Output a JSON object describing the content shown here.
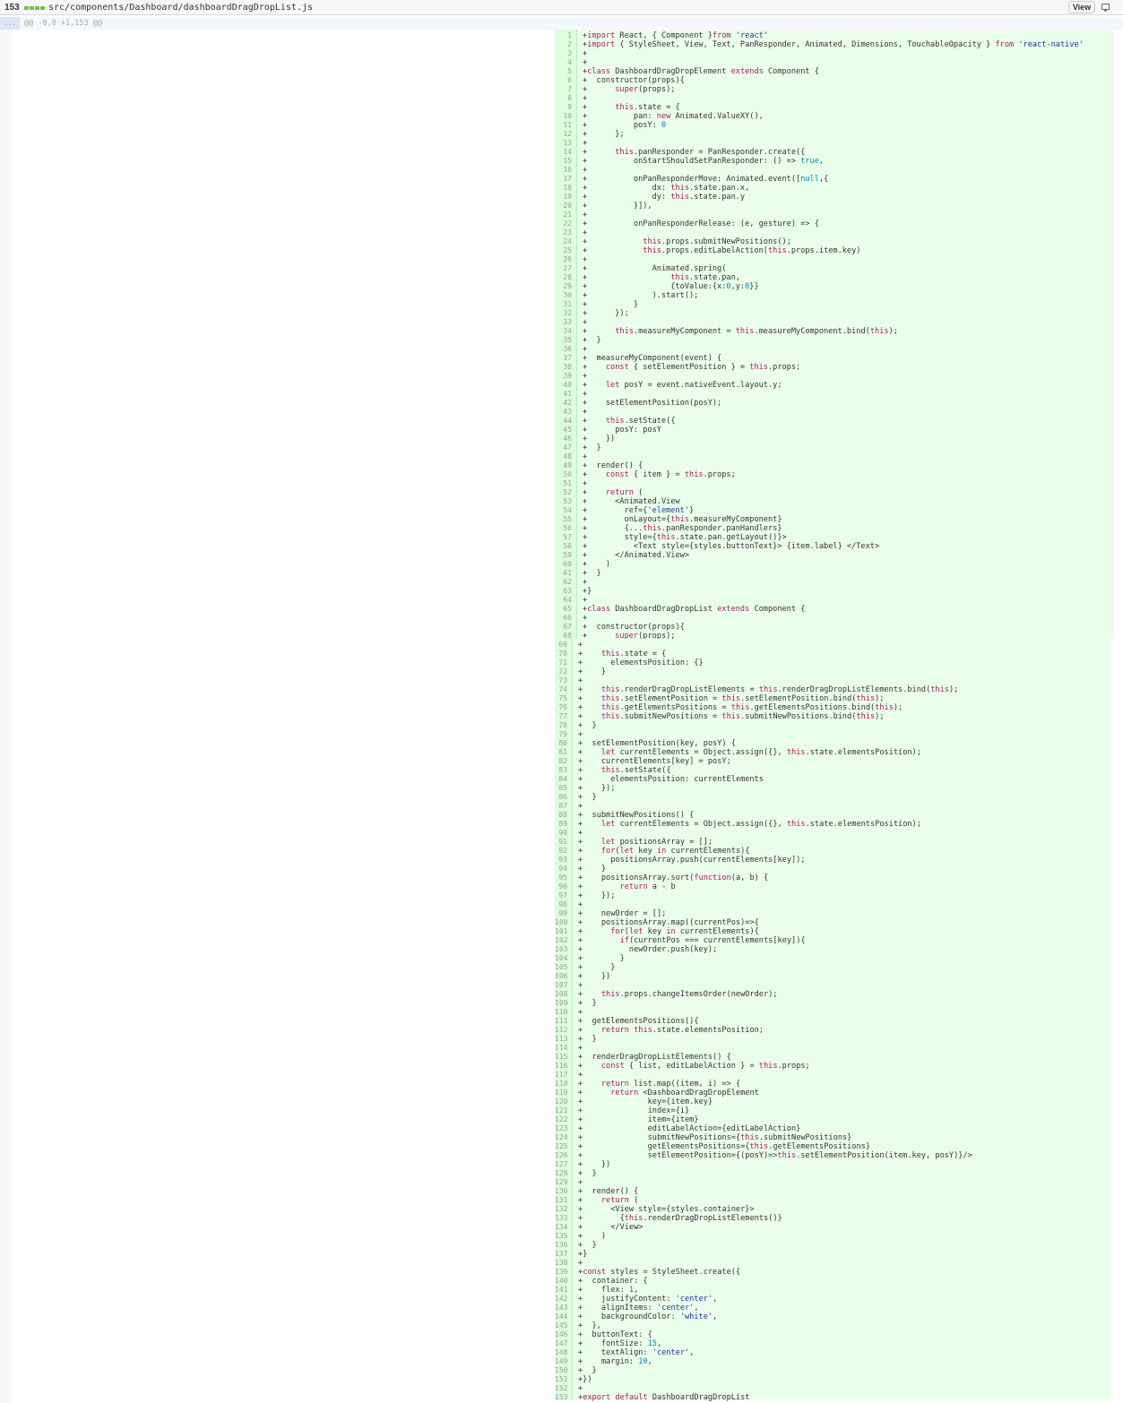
{
  "file": {
    "additions_count": "153",
    "path": "src/components/Dashboard/dashboardDragDropList.js",
    "view_label": "View",
    "view_icon": "monitor-icon"
  },
  "hunk": {
    "expand_label": "...",
    "header": "@@ -0,0 +1,153 @@"
  },
  "colors": {
    "addition_bg": "#eaffea",
    "addition_gutter": "#dbffdb",
    "diffstat": "#6cc644",
    "keyword": "#a71d5d",
    "string": "#183691",
    "function": "#795da3",
    "number": "#0086b3"
  },
  "lines": [
    "+import React, { Component }from 'react'",
    "+import { StyleSheet, View, Text, PanResponder, Animated, Dimensions, TouchableOpacity } from 'react-native'",
    "+",
    "+",
    "+class DashboardDragDropElement extends Component {",
    "+  constructor(props){",
    "+      super(props);",
    "+",
    "+      this.state = {",
    "+          pan: new Animated.ValueXY(),",
    "+          posY: 0",
    "+      };",
    "+",
    "+      this.panResponder = PanResponder.create({",
    "+          onStartShouldSetPanResponder: () => true,",
    "+",
    "+          onPanResponderMove: Animated.event([null,{",
    "+              dx: this.state.pan.x,",
    "+              dy: this.state.pan.y",
    "+          }]),",
    "+",
    "+          onPanResponderRelease: (e, gesture) => {",
    "+",
    "+            this.props.submitNewPositions();",
    "+            this.props.editLabelAction(this.props.item.key)",
    "+",
    "+              Animated.spring(",
    "+                  this.state.pan,",
    "+                  {toValue:{x:0,y:0}}",
    "+              ).start();",
    "+          }",
    "+      });",
    "+",
    "+      this.measureMyComponent = this.measureMyComponent.bind(this);",
    "+  }",
    "+",
    "+  measureMyComponent(event) {",
    "+    const { setElementPosition } = this.props;",
    "+",
    "+    let posY = event.nativeEvent.layout.y;",
    "+",
    "+    setElementPosition(posY);",
    "+",
    "+    this.setState({",
    "+      posY: posY",
    "+    })",
    "+  }",
    "+",
    "+  render() {",
    "+    const { item } = this.props;",
    "+",
    "+    return (",
    "+      <Animated.View",
    "+        ref={'element'}",
    "+        onLayout={this.measureMyComponent}",
    "+        {...this.panResponder.panHandlers}",
    "+        style={this.state.pan.getLayout()}>",
    "+          <Text style={styles.buttonText}> {item.label} </Text>",
    "+      </Animated.View>",
    "+    )",
    "+  }",
    "+",
    "+}",
    "+",
    "+class DashboardDragDropList extends Component {",
    "+",
    "+  constructor(props){",
    "+      super(props);",
    "+",
    "+    this.state = {",
    "+      elementsPosition: {}",
    "+    }",
    "+",
    "+    this.renderDragDropListElements = this.renderDragDropListElements.bind(this);",
    "+    this.setElementPosition = this.setElementPosition.bind(this);",
    "+    this.getElementsPositions = this.getElementsPositions.bind(this);",
    "+    this.submitNewPositions = this.submitNewPositions.bind(this);",
    "+  }",
    "+",
    "+  setElementPosition(key, posY) {",
    "+    let currentElements = Object.assign({}, this.state.elementsPosition);",
    "+    currentElements[key] = posY;",
    "+    this.setState({",
    "+      elementsPosition: currentElements",
    "+    });",
    "+  }",
    "+",
    "+  submitNewPositions() {",
    "+    let currentElements = Object.assign({}, this.state.elementsPosition);",
    "+",
    "+    let positionsArray = [];",
    "+    for(let key in currentElements){",
    "+      positionsArray.push(currentElements[key]);",
    "+    }",
    "+    positionsArray.sort(function(a, b) {",
    "+        return a - b",
    "+    });",
    "+",
    "+    newOrder = [];",
    "+    positionsArray.map((currentPos)=>{",
    "+      for(let key in currentElements){",
    "+        if(currentPos === currentElements[key]){",
    "+          newOrder.push(key);",
    "+        }",
    "+      }",
    "+    })",
    "+",
    "+    this.props.changeItemsOrder(newOrder);",
    "+  }",
    "+",
    "+  getElementsPositions(){",
    "+    return this.state.elementsPosition;",
    "+  }",
    "+",
    "+  renderDragDropListElements() {",
    "+    const { list, editLabelAction } = this.props;",
    "+",
    "+    return list.map((item, i) => {",
    "+      return <DashboardDragDropElement",
    "+              key={item.key}",
    "+              index={i}",
    "+              item={item}",
    "+              editLabelAction={editLabelAction}",
    "+              submitNewPositions={this.submitNewPositions}",
    "+              getElementsPositions={this.getElementsPositions}",
    "+              setElementPosition={(posY)=>this.setElementPosition(item.key, posY)}/>",
    "+    })",
    "+  }",
    "+",
    "+  render() {",
    "+    return (",
    "+      <View style={styles.container}>",
    "+        {this.renderDragDropListElements()}",
    "+      </View>",
    "+    )",
    "+  }",
    "+}",
    "+",
    "+const styles = StyleSheet.create({",
    "+  container: {",
    "+    flex: 1,",
    "+    justifyContent: 'center',",
    "+    alignItems: 'center',",
    "+    backgroundColor: 'white',",
    "+  },",
    "+  buttonText: {",
    "+    fontSize: 15,",
    "+    textAlign: 'center',",
    "+    margin: 10,",
    "+  }",
    "+})",
    "+",
    "+export default DashboardDragDropList"
  ]
}
